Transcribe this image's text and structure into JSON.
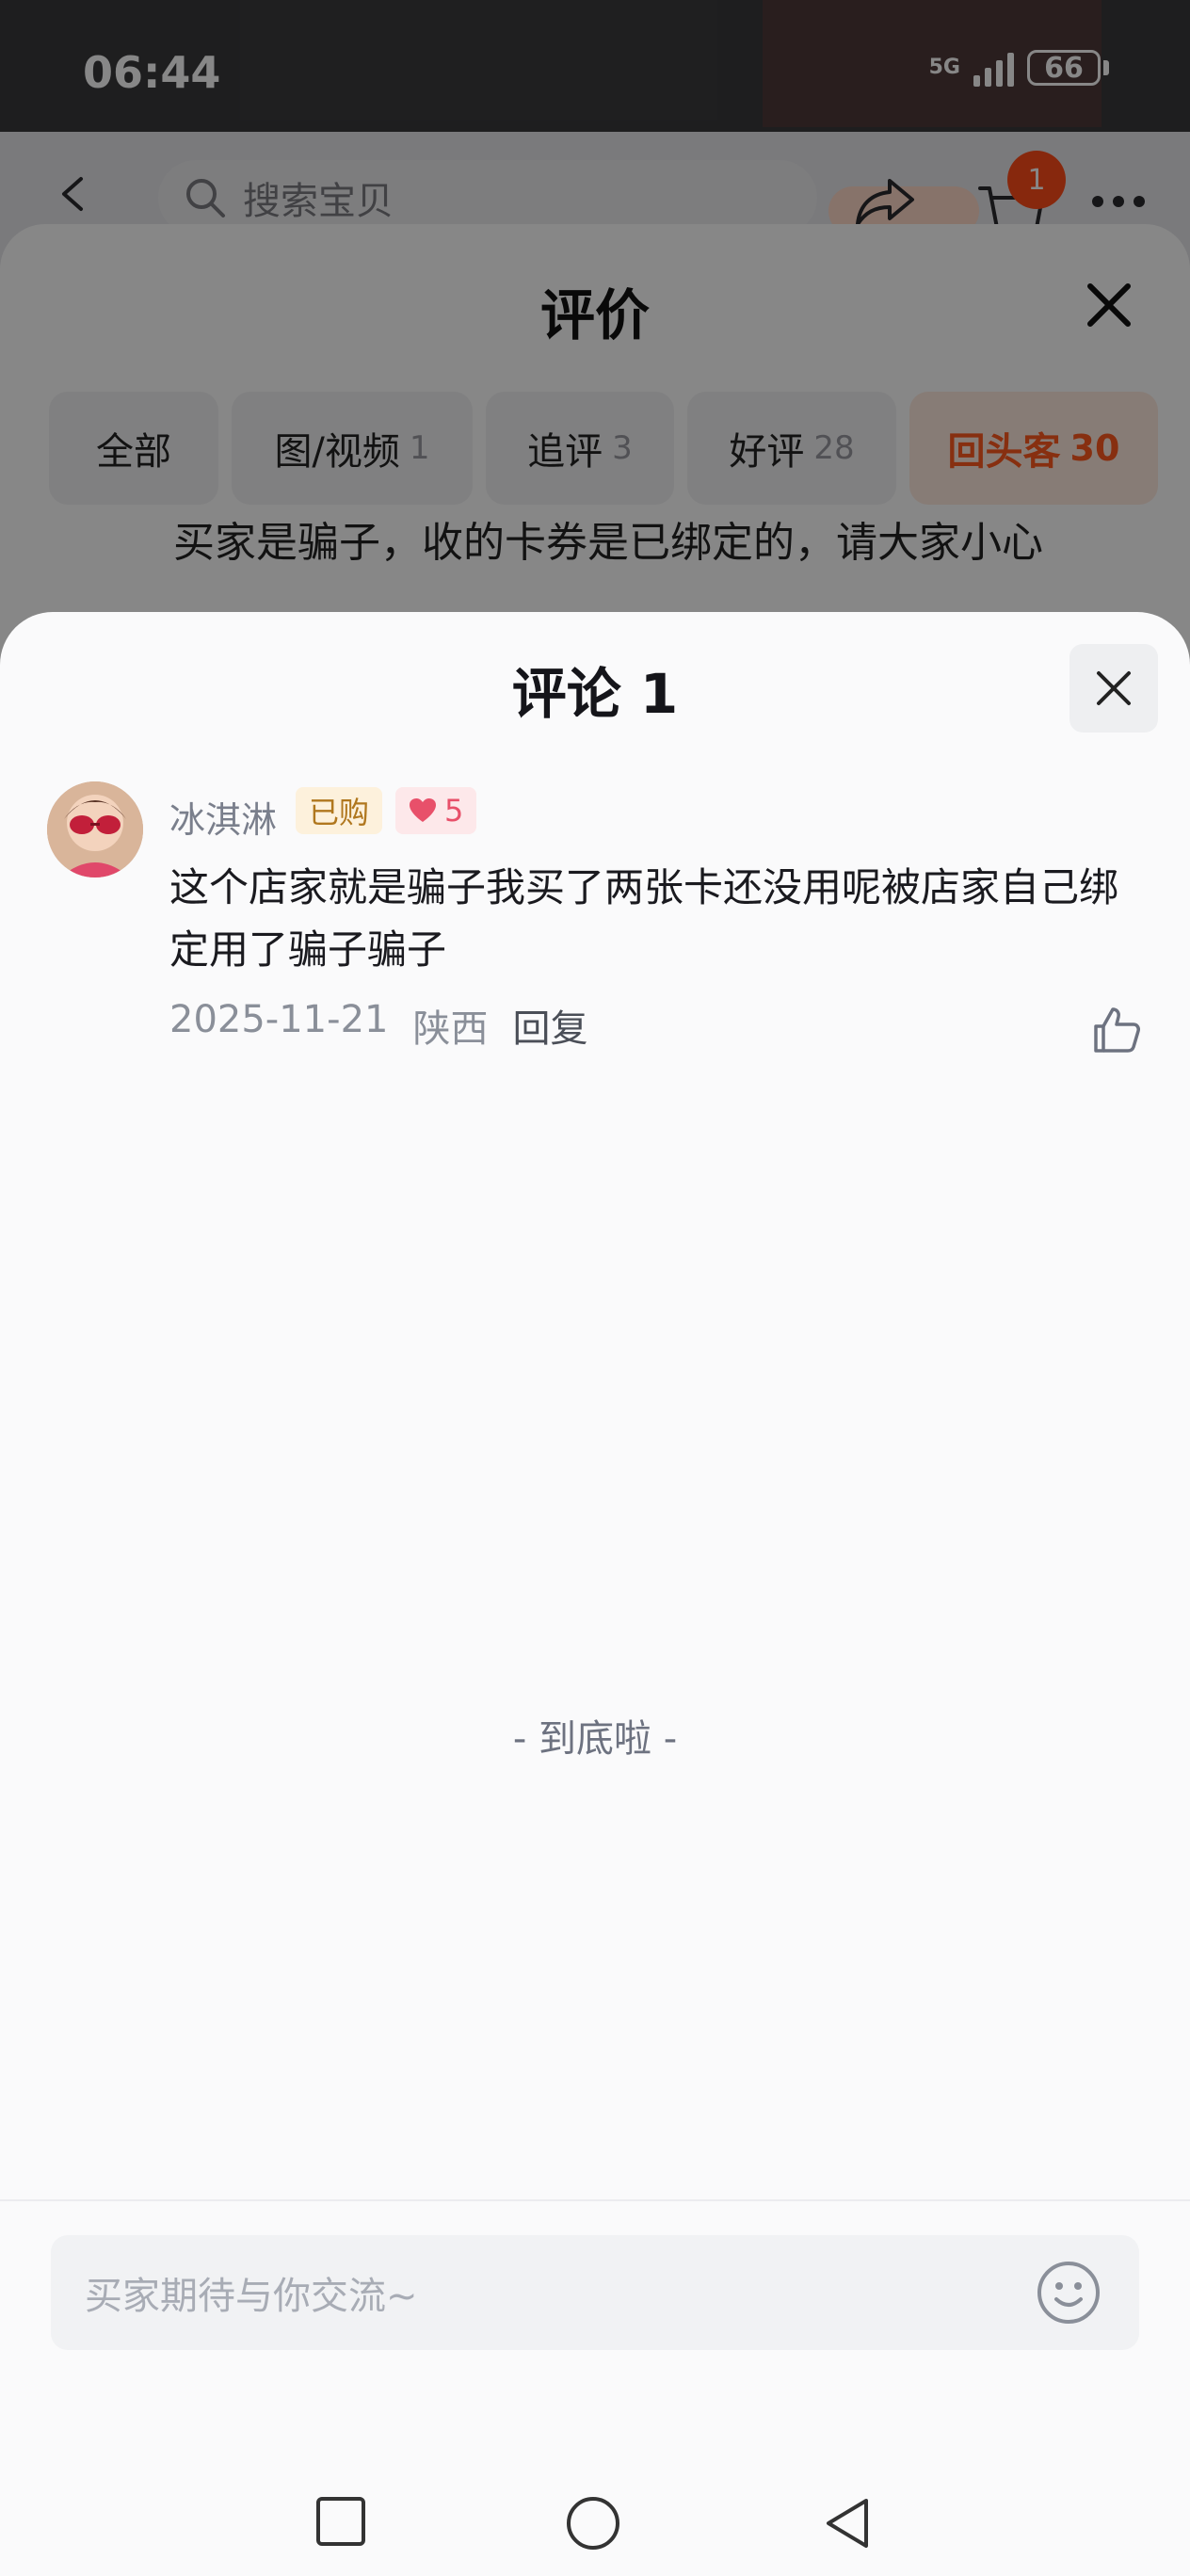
{
  "status_bar": {
    "time": "06:44",
    "network": "5G",
    "battery": "66"
  },
  "background": {
    "search_placeholder": "搜索宝贝",
    "cart_count": "1",
    "reviews": {
      "title": "评价",
      "filters": [
        {
          "label": "全部",
          "count": ""
        },
        {
          "label": "图/视频",
          "count": "1"
        },
        {
          "label": "追评",
          "count": "3"
        },
        {
          "label": "好评",
          "count": "28"
        },
        {
          "label": "回头客",
          "count": "30"
        }
      ],
      "snippet": "买家是骗子，收的卡券是已绑定的，请大家小心"
    }
  },
  "comments_modal": {
    "title": "评论 1",
    "comment": {
      "username": "冰淇淋",
      "bought_badge": "已购",
      "likes": "5",
      "text": "这个店家就是骗子我买了两张卡还没用呢被店家自己绑定用了骗子骗子",
      "date": "2025-11-21",
      "location": "陕西",
      "reply_label": "回复"
    },
    "end_text": "- 到底啦 -",
    "input_placeholder": "买家期待与你交流~"
  },
  "colors": {
    "accent": "#ff5a1f",
    "heart": "#e8506a",
    "bought": "#b0771e"
  }
}
